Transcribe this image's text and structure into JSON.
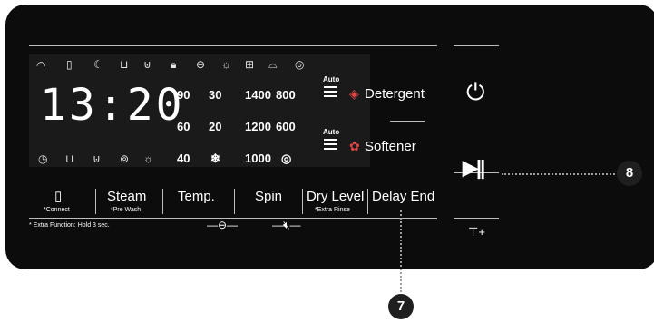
{
  "display": {
    "time": "13:20",
    "top_icons": [
      "wifi-icon",
      "phone-icon",
      "prewash-icon",
      "tub-icon",
      "soak-icon",
      "lock-icon",
      "drum-icon",
      "sun-icon",
      "bottle-icon",
      "iron-icon",
      "spin-small-icon"
    ],
    "bottom_icons": [
      "clock-icon",
      "wash-icon",
      "rinse-icon",
      "spin-icon",
      "dry-sun-icon"
    ],
    "temps": [
      [
        "90",
        "30"
      ],
      [
        "60",
        "20"
      ],
      [
        "40",
        "❄"
      ]
    ],
    "spins": [
      [
        "1400",
        "800"
      ],
      [
        "1200",
        "600"
      ],
      [
        "1000",
        "◎"
      ]
    ],
    "auto_label": "Auto",
    "detergent_label": "Detergent",
    "softener_label": "Softener"
  },
  "buttons": {
    "phone": {
      "label": "▯",
      "sub": "*Connect"
    },
    "steam": {
      "label": "Steam",
      "sub": "*Pre Wash"
    },
    "temp": {
      "label": "Temp.",
      "sub": ""
    },
    "spin": {
      "label": "Spin",
      "sub": ""
    },
    "dry": {
      "label": "Dry Level",
      "sub": "*Extra Rinse"
    },
    "delay": {
      "label": "Delay End",
      "sub": ""
    }
  },
  "footnote": "* Extra Function: Hold 3 sec.",
  "power_icon": "power-icon",
  "play_icon": "play-pause-icon",
  "shirt_icon": "shirt-plus-icon",
  "callouts": {
    "right": "8",
    "bottom": "7"
  }
}
